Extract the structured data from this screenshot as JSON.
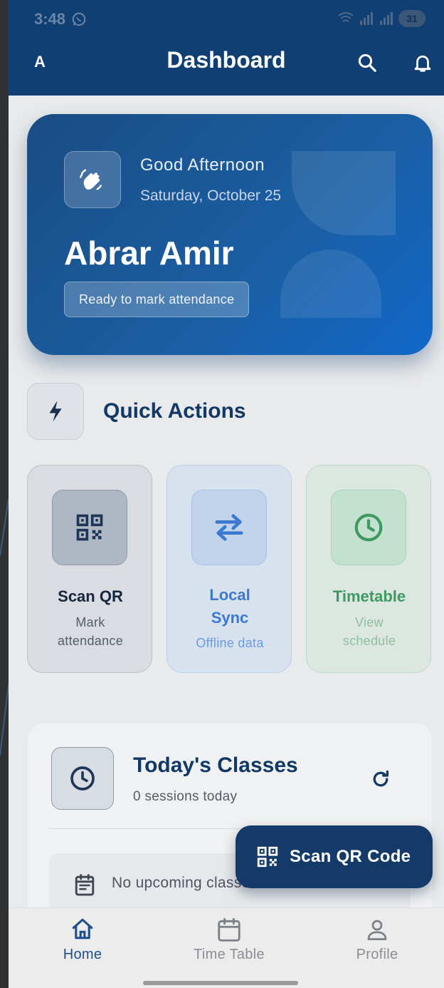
{
  "status_bar": {
    "time": "3:48",
    "battery": "31"
  },
  "app_bar": {
    "avatar_letter": "A",
    "title": "Dashboard"
  },
  "hero": {
    "greeting": "Good Afternoon",
    "date": "Saturday, October 25",
    "name": "Abrar Amir",
    "status_chip": "Ready to mark attendance"
  },
  "quick_actions": {
    "title": "Quick Actions",
    "items": [
      {
        "title": "Scan QR",
        "subtitle_line1": "Mark",
        "subtitle_line2": "attendance",
        "icon": "qr-icon",
        "color": "#1d3557"
      },
      {
        "title_line1": "Local",
        "title_line2": "Sync",
        "subtitle": "Offline data",
        "icon": "swap-icon",
        "color": "#3b7ad0"
      },
      {
        "title": "Timetable",
        "subtitle_line1": "View",
        "subtitle_line2": "schedule",
        "icon": "clock-icon",
        "color": "#3f9a62"
      }
    ]
  },
  "todays_classes": {
    "title": "Today's Classes",
    "subtitle": "0 sessions today",
    "empty_message": "No upcoming classes found"
  },
  "fab": {
    "label": "Scan QR Code"
  },
  "bottom_nav": {
    "items": [
      {
        "label": "Home",
        "icon": "home-icon",
        "active": true
      },
      {
        "label": "Time Table",
        "icon": "calendar-icon",
        "active": false
      },
      {
        "label": "Profile",
        "icon": "person-icon",
        "active": false
      }
    ]
  },
  "colors": {
    "primary": "#0f3f73",
    "accent_blue": "#3b7ad0",
    "accent_green": "#3f9a62"
  }
}
